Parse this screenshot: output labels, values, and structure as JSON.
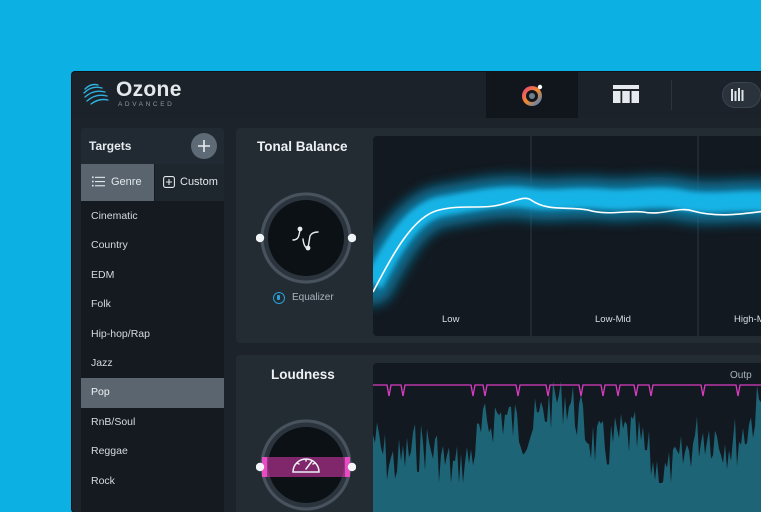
{
  "header": {
    "brand_name": "Ozone",
    "brand_edition": "ADVANCED",
    "tabs": [
      {
        "icon": "assistant-icon",
        "active": true
      },
      {
        "icon": "modules-icon",
        "active": false
      },
      {
        "icon": "meter-icon",
        "active": false
      }
    ]
  },
  "sidebar": {
    "title": "Targets",
    "add_icon": "plus-icon",
    "segments": {
      "genre": "Genre",
      "custom": "Custom"
    },
    "items": [
      "Cinematic",
      "Country",
      "EDM",
      "Folk",
      "Hip-hop/Rap",
      "Jazz",
      "Pop",
      "RnB/Soul",
      "Reggae",
      "Rock"
    ],
    "selected": "Pop"
  },
  "tonal_balance": {
    "title": "Tonal Balance",
    "knob_label": "Equalizer",
    "bands": [
      "Low",
      "Low-Mid",
      "High-M"
    ]
  },
  "loudness": {
    "title": "Loudness",
    "output_label": "Outp"
  },
  "colors": {
    "background": "#0cb0e2",
    "accent_cyan": "#1ab8e8",
    "accent_magenta": "#e03bb4"
  }
}
